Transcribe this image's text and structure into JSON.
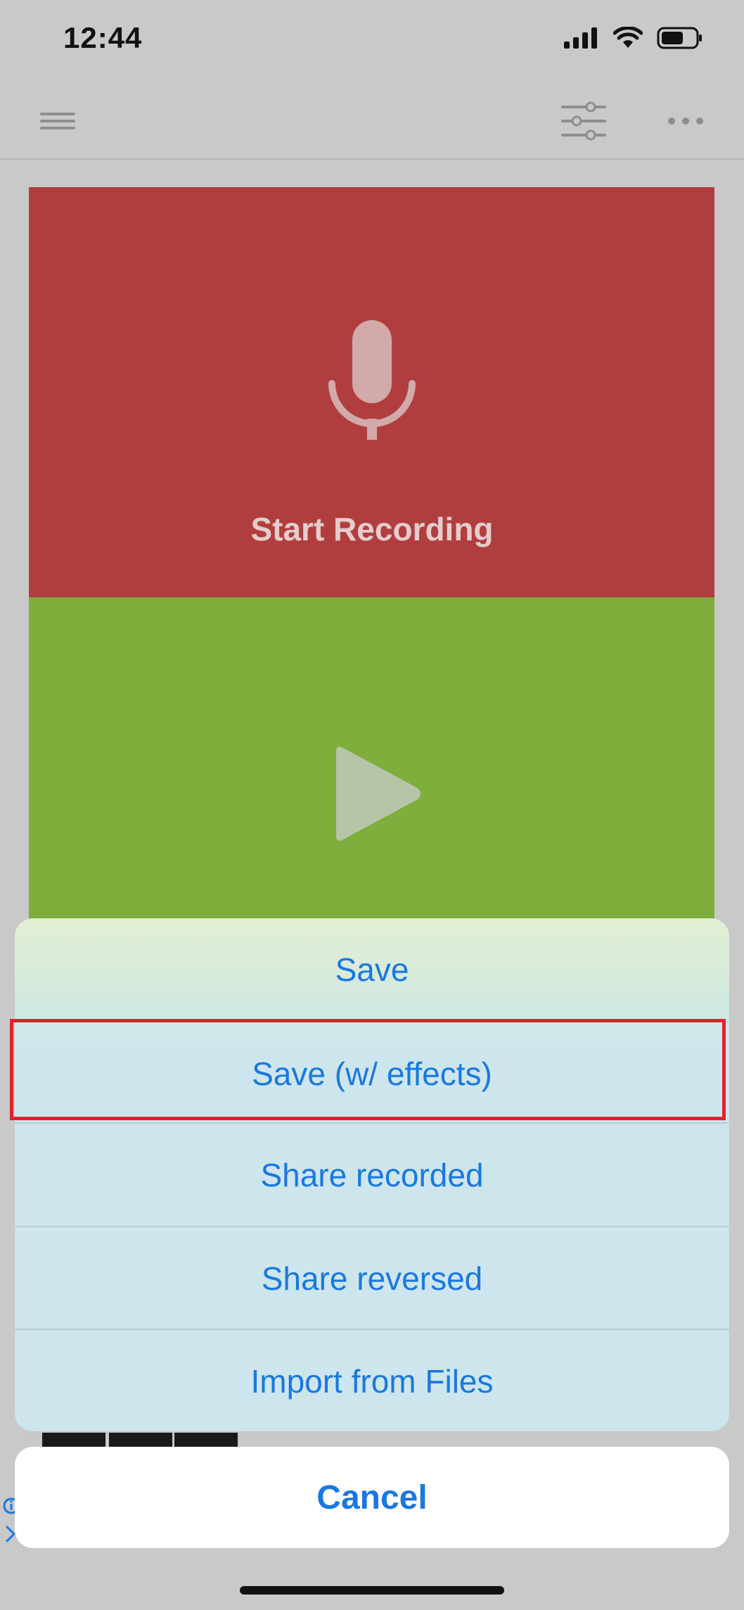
{
  "status_bar": {
    "time": "12:44",
    "signal_icon": "cellular-signal-icon",
    "wifi_icon": "wifi-icon",
    "battery_icon": "battery-icon"
  },
  "nav_bar": {
    "menu_icon": "hamburger-menu-icon",
    "settings_icon": "sliders-icon",
    "more_icon": "more-horizontal-icon"
  },
  "record_tile": {
    "label": "Start Recording",
    "icon": "microphone-icon",
    "color": "#b13e3e"
  },
  "play_tile": {
    "icon": "play-icon",
    "color": "#7eae3b"
  },
  "action_sheet": {
    "items": [
      {
        "label": "Save"
      },
      {
        "label": "Save (w/ effects)",
        "highlighted": true
      },
      {
        "label": "Share recorded"
      },
      {
        "label": "Share reversed"
      },
      {
        "label": "Import from Files"
      }
    ],
    "cancel_label": "Cancel",
    "accent_color": "#1a78e0",
    "highlight_color": "#e0212b"
  }
}
